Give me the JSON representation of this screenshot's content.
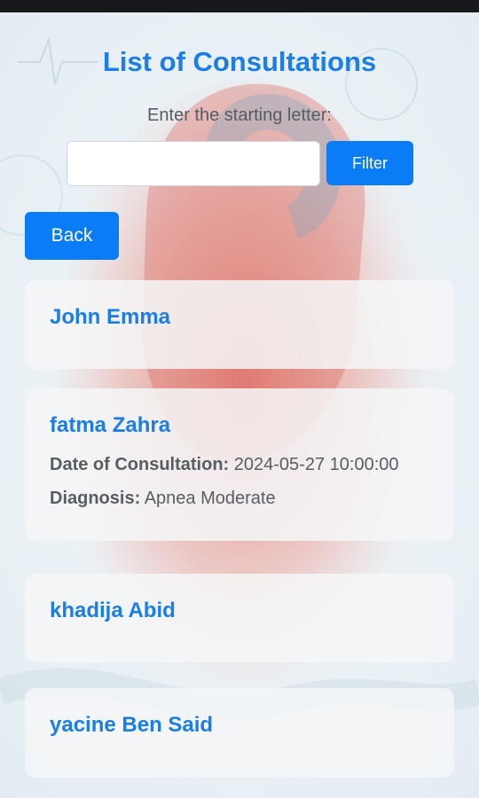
{
  "page": {
    "title": "List of Consultations",
    "prompt": "Enter the starting letter:"
  },
  "filter": {
    "value": "",
    "placeholder": "",
    "button_label": "Filter"
  },
  "back_label": "Back",
  "consultations": [
    {
      "name": "John Emma"
    },
    {
      "name": "fatma Zahra",
      "date_label": "Date of Consultation:",
      "date_value": "2024-05-27 10:00:00",
      "diagnosis_label": "Diagnosis:",
      "diagnosis_value": "Apnea Moderate"
    },
    {
      "name": "khadija Abid"
    },
    {
      "name": "yacine Ben Said"
    }
  ],
  "colors": {
    "accent": "#0a7cf5",
    "title": "#1a7ee6",
    "text": "#575d62"
  }
}
